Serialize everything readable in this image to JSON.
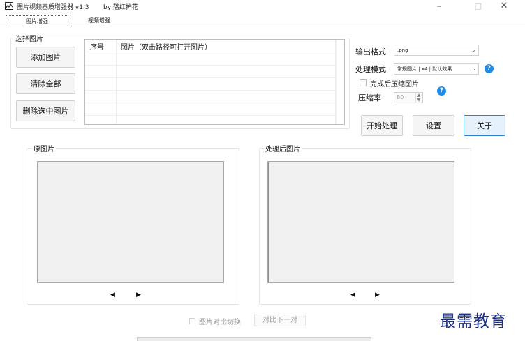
{
  "window": {
    "title": "图片视频画质增强器 v1.3",
    "by": "by 落红护花",
    "min_glyph": "–",
    "max_glyph": "□",
    "close_glyph": "✕"
  },
  "tabs": [
    {
      "label": "图片增强"
    },
    {
      "label": "视频增强"
    }
  ],
  "select_group": {
    "label": "选择图片",
    "add_button": "添加图片",
    "clear_button": "清除全部",
    "delete_button": "删除选中图片",
    "columns": [
      "序号",
      "图片（双击路径可打开图片）"
    ]
  },
  "settings": {
    "output_format_label": "输出格式",
    "output_format_value": ".png",
    "mode_label": "处理模式",
    "mode_value": "常规图片 | x4 | 默认效果",
    "compress_checkbox_label": "完成后压缩图片",
    "compress_checked": false,
    "ratio_label": "压缩率",
    "ratio_value": "80",
    "help_glyph": "?",
    "start_button": "开始处理",
    "config_button": "设置",
    "about_button": "关于"
  },
  "original": {
    "label": "原图片",
    "prev_glyph": "◀",
    "next_glyph": "▶"
  },
  "processed": {
    "label": "处理后图片",
    "prev_glyph": "◀",
    "next_glyph": "▶"
  },
  "bottom": {
    "compare_toggle_label": "图片对比切换",
    "compare_next_button": "对比下一对"
  },
  "watermark": "最需教育",
  "colors": {
    "accent": "#2b7cd3",
    "help": "#1e8ae6",
    "watermark": "#1a2f8a"
  }
}
